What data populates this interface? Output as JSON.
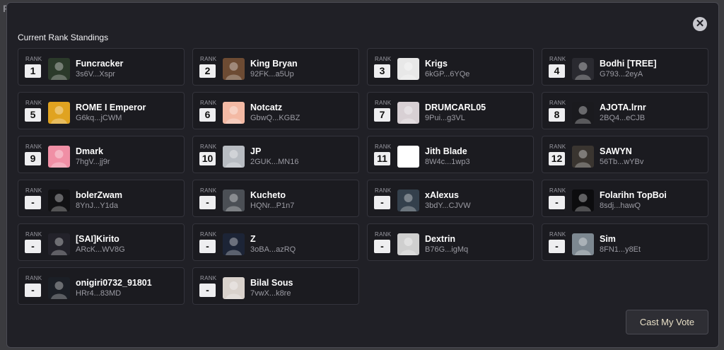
{
  "backdrop_text": "R",
  "modal": {
    "title": "Current Rank Standings",
    "close_glyph": "✕",
    "rank_label": "RANK",
    "vote_button": "Cast My Vote"
  },
  "standings": [
    {
      "rank": "1",
      "name": "Funcracker",
      "address": "3s6V...Xspr",
      "avatar_icon": "green-alien-icon",
      "avatar_color": "#2b3a2a"
    },
    {
      "rank": "2",
      "name": "King Bryan",
      "address": "92FK...a5Up",
      "avatar_icon": "bearded-man-icon",
      "avatar_color": "#6d4b33"
    },
    {
      "rank": "3",
      "name": "Krigs",
      "address": "6kGP...6YQe",
      "avatar_icon": "skeleton-hand-icon",
      "avatar_color": "#e8e8e8"
    },
    {
      "rank": "4",
      "name": "Bodhi [TREE]",
      "address": "G793...2eyA",
      "avatar_icon": "dark-creature-icon",
      "avatar_color": "#2a2a30"
    },
    {
      "rank": "5",
      "name": "ROME I Emperor",
      "address": "G6kq...jCWM",
      "avatar_icon": "gold-shield-icon",
      "avatar_color": "#e0a320"
    },
    {
      "rank": "6",
      "name": "Notcatz",
      "address": "GbwQ...KGBZ",
      "avatar_icon": "pink-bear-icon",
      "avatar_color": "#f3b9a4"
    },
    {
      "rank": "7",
      "name": "DRUMCARL05",
      "address": "9Pui...g3VL",
      "avatar_icon": "red-shirt-man-icon",
      "avatar_color": "#d8d0d4"
    },
    {
      "rank": "8",
      "name": "AJOTA.lrnr",
      "address": "2BQ4...eCJB",
      "avatar_icon": "helmet-icon",
      "avatar_color": "#1a1a1e"
    },
    {
      "rank": "9",
      "name": "Dmark",
      "address": "7hgV...jj9r",
      "avatar_icon": "pink-cartoon-icon",
      "avatar_color": "#f08fa5"
    },
    {
      "rank": "10",
      "name": "JP",
      "address": "2GUK...MN16",
      "avatar_icon": "glasses-man-icon",
      "avatar_color": "#b8bcc2"
    },
    {
      "rank": "11",
      "name": "Jith Blade",
      "address": "8W4c...1wp3",
      "avatar_icon": "green-skull-icon",
      "avatar_color": "#ffffff"
    },
    {
      "rank": "12",
      "name": "SAWYN",
      "address": "56Tb...wYBv",
      "avatar_icon": "horned-beast-icon",
      "avatar_color": "#3a3530"
    },
    {
      "rank": "-",
      "name": "bolerZwam",
      "address": "8YnJ...Y1da",
      "avatar_icon": "green-figure-icon",
      "avatar_color": "#121214"
    },
    {
      "rank": "-",
      "name": "Kucheto",
      "address": "HQNr...P1n7",
      "avatar_icon": "robot-icon",
      "avatar_color": "#4b4f55"
    },
    {
      "rank": "-",
      "name": "xAlexus",
      "address": "3bdY...CJVW",
      "avatar_icon": "warrior-icon",
      "avatar_color": "#34404c"
    },
    {
      "rank": "-",
      "name": "Folarihn TopBoi",
      "address": "8sdj...hawQ",
      "avatar_icon": "red-logo-icon",
      "avatar_color": "#0c0c0e"
    },
    {
      "rank": "-",
      "name": "[SAI]Kirito",
      "address": "ARcK...WV8G",
      "avatar_icon": "purple-dragon-icon",
      "avatar_color": "#23222a"
    },
    {
      "rank": "-",
      "name": "Z",
      "address": "3oBA...azRQ",
      "avatar_icon": "blue-spirit-icon",
      "avatar_color": "#1c2436"
    },
    {
      "rank": "-",
      "name": "Dextrin",
      "address": "B76G...igMq",
      "avatar_icon": "bw-portrait-icon",
      "avatar_color": "#cfcfcf"
    },
    {
      "rank": "-",
      "name": "Sim",
      "address": "8FN1...y8Et",
      "avatar_icon": "soldier-icon",
      "avatar_color": "#7d8891"
    },
    {
      "rank": "-",
      "name": "onigiri0732_91801",
      "address": "HRr4...83MD",
      "avatar_icon": "dark-warrior-icon",
      "avatar_color": "#1b1f26"
    },
    {
      "rank": "-",
      "name": "Bilal Sous",
      "address": "7vwX...k8re",
      "avatar_icon": "smiling-man-icon",
      "avatar_color": "#d9d2cc"
    }
  ]
}
